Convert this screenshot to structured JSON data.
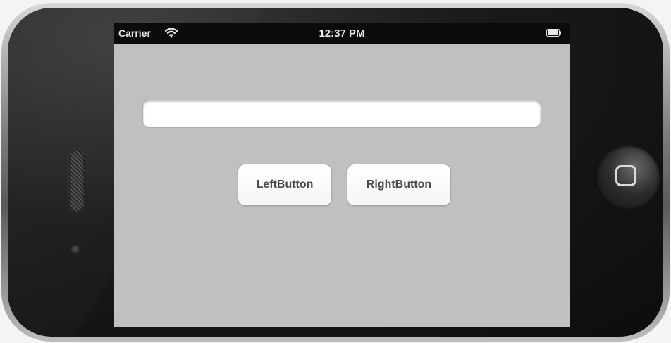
{
  "status_bar": {
    "carrier": "Carrier",
    "time": "12:37 PM",
    "wifi_icon": "wifi-icon",
    "battery_icon": "battery-icon"
  },
  "text_field": {
    "value": "",
    "placeholder": ""
  },
  "buttons": {
    "left_label": "LeftButton",
    "right_label": "RightButton"
  },
  "device": {
    "home_button_icon": "home-button-icon",
    "speaker": "speaker",
    "camera": "camera"
  },
  "colors": {
    "screen_background": "#c0c0c0",
    "status_bar_background": "#0b0b0b",
    "button_text": "#4a4a4a"
  }
}
